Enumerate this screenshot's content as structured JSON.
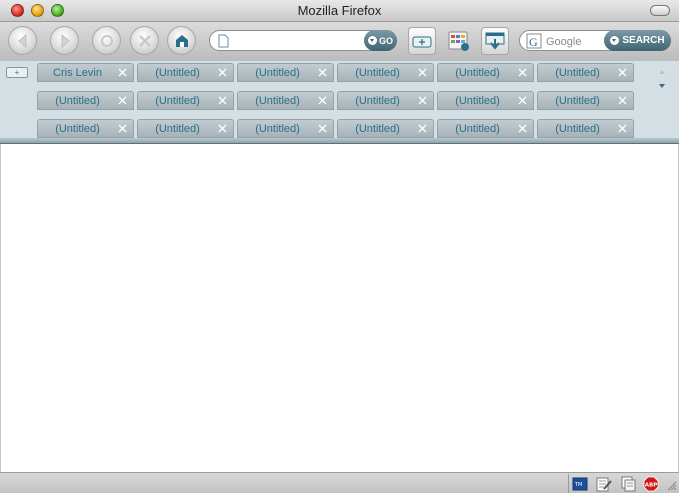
{
  "window": {
    "title": "Mozilla Firefox"
  },
  "toolbar": {
    "url_value": "",
    "go_label": "GO",
    "search_placeholder": "Google",
    "search_label": "SEARCH"
  },
  "tabs": {
    "row1": [
      "Cris Levin",
      "(Untitled)",
      "(Untitled)",
      "(Untitled)",
      "(Untitled)",
      "(Untitled)"
    ],
    "row2": [
      "(Untitled)",
      "(Untitled)",
      "(Untitled)",
      "(Untitled)",
      "(Untitled)",
      "(Untitled)"
    ],
    "row3": [
      "(Untitled)",
      "(Untitled)",
      "(Untitled)",
      "(Untitled)",
      "(Untitled)",
      "(Untitled)"
    ]
  },
  "colors": {
    "tab_text": "#2a6f8a",
    "tabstrip_bg": "#d3dfe3",
    "accent_button": "#3f6471",
    "abp_red": "#d01818"
  },
  "icons": {
    "toolbar": [
      "back-icon",
      "forward-icon",
      "reload-icon",
      "stop-icon",
      "home-icon",
      "new-tab-icon",
      "grid-icon",
      "download-icon"
    ],
    "status": [
      "bookmark-icon",
      "edit-icon",
      "notes-icon",
      "adblock-icon"
    ]
  },
  "status": {
    "abp_label": "ABP"
  }
}
